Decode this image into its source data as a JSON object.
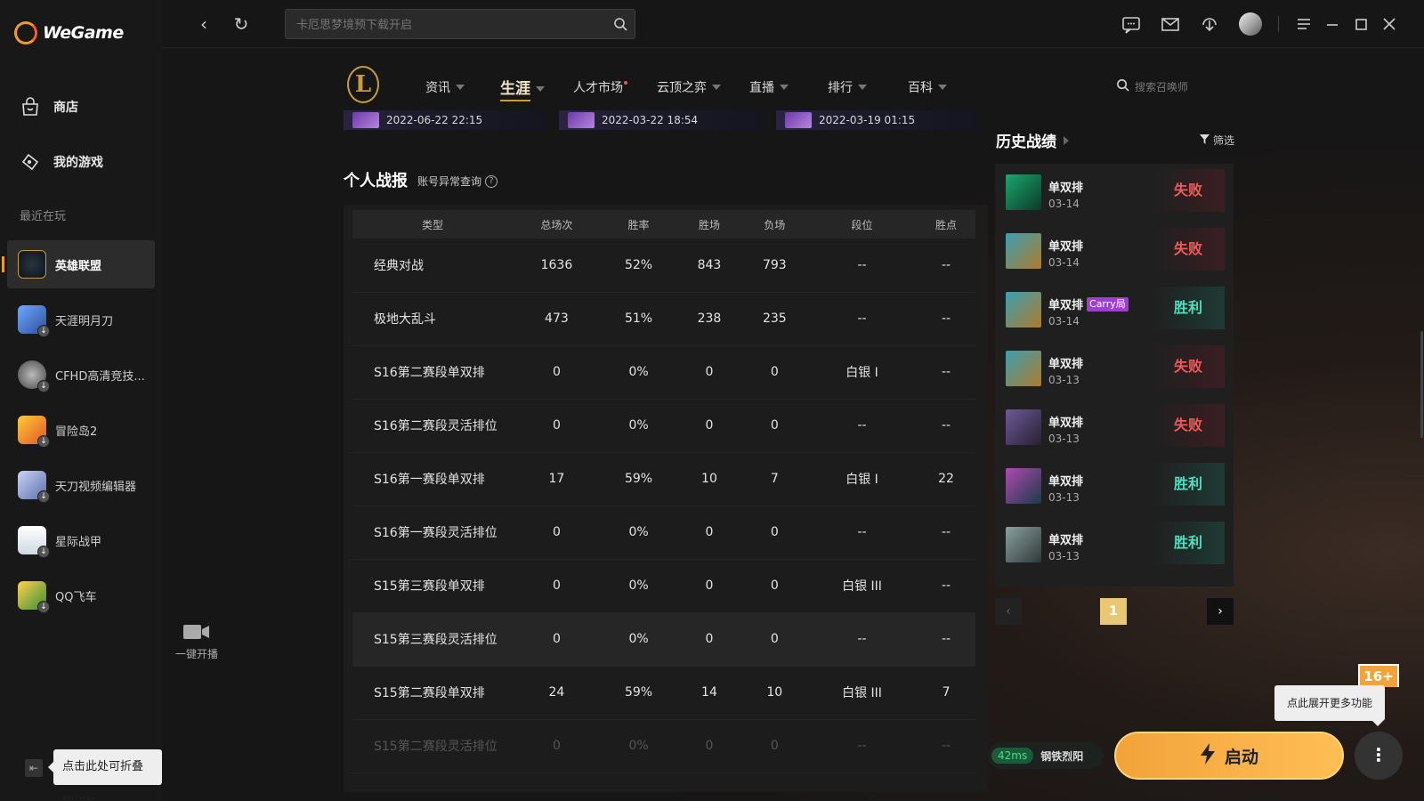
{
  "app": {
    "name": "WeGame"
  },
  "sidebar": {
    "nav": [
      {
        "label": "商店",
        "icon": "shop-bag-icon"
      },
      {
        "label": "我的游戏",
        "icon": "gamepad-icon"
      }
    ],
    "recent_label": "最近在玩",
    "games": [
      {
        "label": "英雄联盟",
        "icon": "league-of-legends-icon",
        "active": true
      },
      {
        "label": "天涯明月刀",
        "icon": "tianya-icon"
      },
      {
        "label": "CFHD高清竞技...",
        "icon": "cfhd-icon"
      },
      {
        "label": "冒险岛2",
        "icon": "maplestory2-icon"
      },
      {
        "label": "天刀视频编辑器",
        "icon": "video-editor-icon"
      },
      {
        "label": "星际战甲",
        "icon": "warframe-icon"
      },
      {
        "label": "QQ飞车",
        "icon": "qq-speed-icon"
      }
    ],
    "collapse_tip": "点击此处可折叠侧边栏",
    "stream_label": "一键开播"
  },
  "topbar": {
    "search_placeholder": "卡厄思梦境预下载开启"
  },
  "gamenav": {
    "items": [
      {
        "label": "资讯",
        "caret": true
      },
      {
        "label": "生涯",
        "caret": true,
        "active": true
      },
      {
        "label": "人才市场",
        "caret": false,
        "dot": true
      },
      {
        "label": "云顶之弈",
        "caret": true
      },
      {
        "label": "直播",
        "caret": true
      },
      {
        "label": "排行",
        "caret": true
      },
      {
        "label": "百科",
        "caret": true
      }
    ],
    "search_placeholder": "搜索召唤师"
  },
  "video_thumbs": [
    "2022-06-22 22:15",
    "2022-03-22 18:54",
    "2022-03-19 01:15"
  ],
  "stats": {
    "title": "个人战报",
    "account_link": "账号异常查询",
    "headers": [
      "类型",
      "总场次",
      "胜率",
      "胜场",
      "负场",
      "段位",
      "胜点"
    ],
    "rows": [
      [
        "经典对战",
        "1636",
        "52%",
        "843",
        "793",
        "--",
        "--"
      ],
      [
        "极地大乱斗",
        "473",
        "51%",
        "238",
        "235",
        "--",
        "--"
      ],
      [
        "S16第二赛段单双排",
        "0",
        "0%",
        "0",
        "0",
        "白银 I",
        "--"
      ],
      [
        "S16第二赛段灵活排位",
        "0",
        "0%",
        "0",
        "0",
        "--",
        "--"
      ],
      [
        "S16第一赛段单双排",
        "17",
        "59%",
        "10",
        "7",
        "白银 I",
        "22"
      ],
      [
        "S16第一赛段灵活排位",
        "0",
        "0%",
        "0",
        "0",
        "--",
        "--"
      ],
      [
        "S15第三赛段单双排",
        "0",
        "0%",
        "0",
        "0",
        "白银 III",
        "--"
      ],
      [
        "S15第三赛段灵活排位",
        "0",
        "0%",
        "0",
        "0",
        "--",
        "--"
      ],
      [
        "S15第二赛段单双排",
        "24",
        "59%",
        "14",
        "10",
        "白银 III",
        "7"
      ],
      [
        "S15第二赛段灵活排位",
        "0",
        "0%",
        "0",
        "0",
        "--",
        "--"
      ]
    ]
  },
  "history": {
    "title": "历史战绩",
    "filter_label": "筛选",
    "matches": [
      {
        "mode": "单双排",
        "date": "03-14",
        "result": "失败",
        "win": false,
        "carry": false
      },
      {
        "mode": "单双排",
        "date": "03-14",
        "result": "失败",
        "win": false,
        "carry": false
      },
      {
        "mode": "单双排",
        "date": "03-14",
        "result": "胜利",
        "win": true,
        "carry": true,
        "carry_label": "Carry局"
      },
      {
        "mode": "单双排",
        "date": "03-13",
        "result": "失败",
        "win": false,
        "carry": false
      },
      {
        "mode": "单双排",
        "date": "03-13",
        "result": "失败",
        "win": false,
        "carry": false
      },
      {
        "mode": "单双排",
        "date": "03-13",
        "result": "胜利",
        "win": true,
        "carry": false
      },
      {
        "mode": "单双排",
        "date": "03-13",
        "result": "胜利",
        "win": true,
        "carry": false
      }
    ],
    "page": "1"
  },
  "launch": {
    "ping": "42ms",
    "region": "钢铁烈阳",
    "button": "启动",
    "more_tip": "点此展开更多功能",
    "age_rating": "16+"
  },
  "colors": {
    "accent": "#f2a33a",
    "lose": "#f05a5a",
    "win": "#4fe0c0",
    "gold": "#c89b3c"
  }
}
